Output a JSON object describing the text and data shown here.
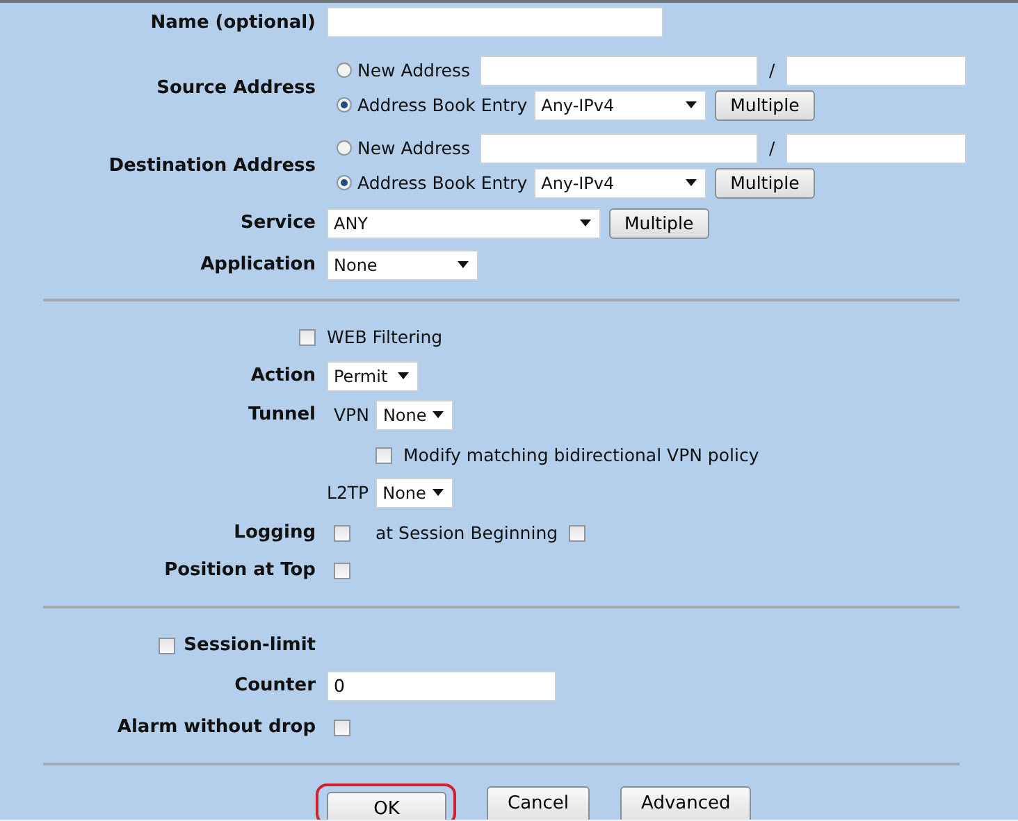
{
  "name_field": {
    "label": "Name (optional)"
  },
  "source_address": {
    "label": "Source Address",
    "separator": "/",
    "options": [
      {
        "kind": "new",
        "label": "New Address",
        "selected": false
      },
      {
        "kind": "book",
        "label": "Address Book Entry",
        "selected": true,
        "value": "Any-IPv4",
        "button": "Multiple"
      }
    ]
  },
  "destination_address": {
    "label": "Destination Address",
    "separator": "/",
    "options": [
      {
        "kind": "new",
        "label": "New Address",
        "selected": false
      },
      {
        "kind": "book",
        "label": "Address Book Entry",
        "selected": true,
        "value": "Any-IPv4",
        "button": "Multiple"
      }
    ]
  },
  "service": {
    "label": "Service",
    "value": "ANY",
    "button": "Multiple"
  },
  "application": {
    "label": "Application",
    "value": "None"
  },
  "web_filtering": {
    "label": "WEB Filtering",
    "checked": false
  },
  "action": {
    "label": "Action",
    "value": "Permit"
  },
  "tunnel": {
    "label": "Tunnel",
    "vpn_label": "VPN",
    "vpn_value": "None",
    "modify_label": "Modify matching bidirectional VPN policy",
    "modify_checked": false,
    "l2tp_label": "L2TP",
    "l2tp_value": "None"
  },
  "logging": {
    "label": "Logging",
    "checked": false,
    "session_label": "at Session Beginning",
    "session_checked": false
  },
  "position_at_top": {
    "label": "Position at Top",
    "checked": false
  },
  "session_limit": {
    "label": "Session-limit",
    "checked": false
  },
  "counter": {
    "label": "Counter",
    "value": "0"
  },
  "alarm_without_drop": {
    "label": "Alarm without drop",
    "checked": false
  },
  "buttons": [
    {
      "label": "OK",
      "highlighted": true
    },
    {
      "label": "Cancel",
      "highlighted": false
    },
    {
      "label": "Advanced",
      "highlighted": false
    }
  ]
}
